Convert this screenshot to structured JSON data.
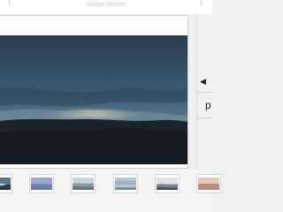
{
  "window": {
    "title": "Image Viewer"
  },
  "preview": {
    "description": "sunset-sky-photo"
  },
  "side": {
    "prev_icon": "◀",
    "label": "p"
  },
  "thumbnails": [
    {
      "name": "thumb-1"
    },
    {
      "name": "thumb-2"
    },
    {
      "name": "thumb-3"
    },
    {
      "name": "thumb-4"
    },
    {
      "name": "thumb-5"
    },
    {
      "name": "thumb-6"
    }
  ]
}
